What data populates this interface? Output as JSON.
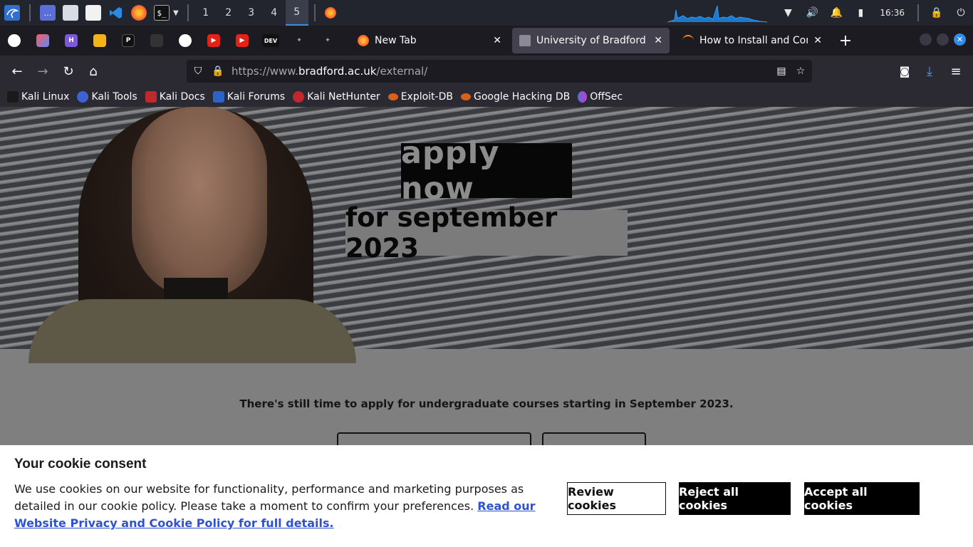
{
  "system_panel": {
    "workspaces": [
      "1",
      "2",
      "3",
      "4",
      "5"
    ],
    "active_workspace": "5",
    "clock": "16:36"
  },
  "browser": {
    "tabs": [
      {
        "title": "New Tab",
        "favicon": "firefox-icon"
      },
      {
        "title": "University of Bradford",
        "favicon": "page-icon",
        "selected": true
      },
      {
        "title": "How to Install and Configu",
        "favicon": "loading-icon"
      }
    ],
    "url": {
      "prefix": "https://www.",
      "domain": "bradford.ac.uk",
      "path": "/external/"
    },
    "bookmarks": [
      {
        "label": "Kali Linux",
        "color": "#1a1a1a"
      },
      {
        "label": "Kali Tools",
        "color": "#3c63d6"
      },
      {
        "label": "Kali Docs",
        "color": "#c0282d"
      },
      {
        "label": "Kali Forums",
        "color": "#2c63c9"
      },
      {
        "label": "Kali NetHunter",
        "color": "#c0282d"
      },
      {
        "label": "Exploit-DB",
        "color": "#d8621c"
      },
      {
        "label": "Google Hacking DB",
        "color": "#d8621c"
      },
      {
        "label": "OffSec",
        "color": "#5b6cd8"
      }
    ]
  },
  "page": {
    "hero": {
      "headline": "apply now",
      "subheadline": "for september 2023"
    },
    "intro": "There's still time to apply for undergraduate courses starting in September 2023."
  },
  "cookie_banner": {
    "title": "Your cookie consent",
    "body": "We use cookies on our website for functionality, performance and marketing purposes as detailed in our cookie policy. Please take a moment to confirm your preferences. ",
    "link": "Read our Website Privacy and Cookie Policy for full details.",
    "buttons": {
      "review": "Review cookies",
      "reject": "Reject all cookies",
      "accept": "Accept all cookies"
    }
  }
}
